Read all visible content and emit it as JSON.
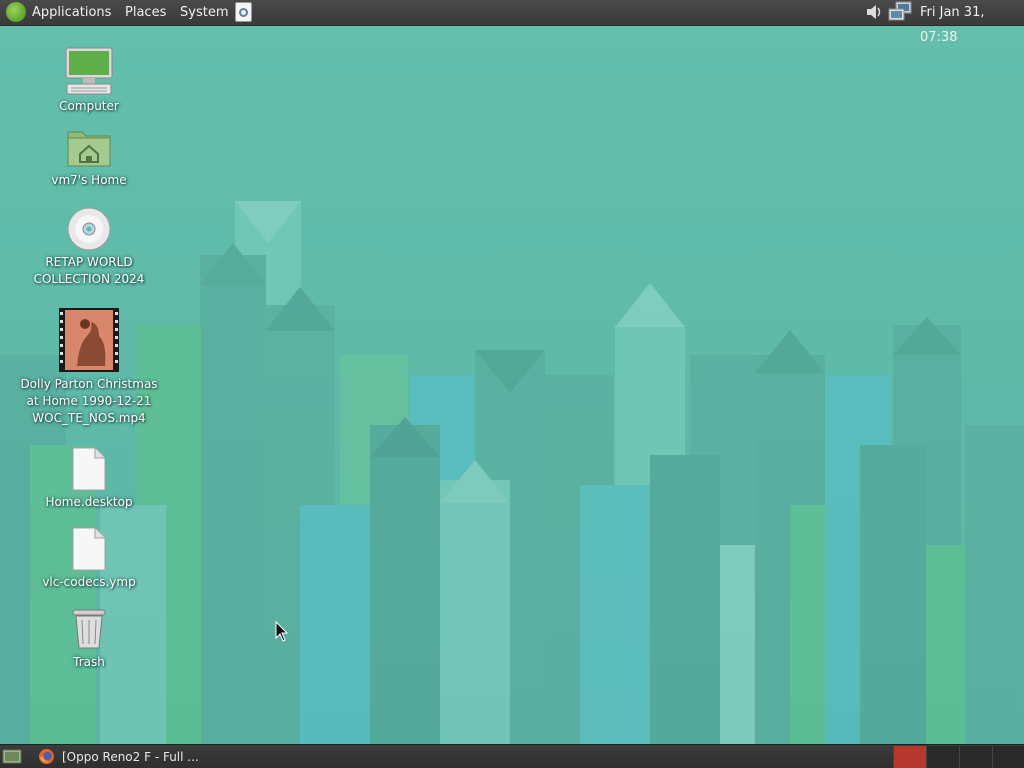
{
  "top_panel": {
    "menus": [
      {
        "label": "Applications",
        "icon": "distro-logo-icon"
      },
      {
        "label": "Places"
      },
      {
        "label": "System"
      }
    ],
    "launcher_icon": "note-launcher-icon",
    "tray_icons": [
      "volume-icon",
      "network-icon"
    ],
    "clock": "Fri Jan 31, 07:38"
  },
  "desktop": {
    "icons": [
      {
        "label": "Computer",
        "icon": "computer-icon"
      },
      {
        "label": "vm7's Home",
        "icon": "home-folder-icon"
      },
      {
        "label": "RETAP WORLD\nCOLLECTION 2024",
        "icon": "optical-disc-icon"
      },
      {
        "label": "Dolly Parton Christmas\nat Home 1990-12-21\nWOC_TE_NOS.mp4",
        "icon": "video-thumbnail-icon"
      },
      {
        "label": "Home.desktop",
        "icon": "document-icon"
      },
      {
        "label": "vlc-codecs.ymp",
        "icon": "document-icon"
      },
      {
        "label": "Trash",
        "icon": "trash-icon"
      }
    ],
    "wallpaper_colors": {
      "base": "#5fbaa8",
      "light": "#7fd0c0",
      "green": "#5ec48a",
      "blue": "#56c0cf"
    }
  },
  "bottom_panel": {
    "task": {
      "label": "[Oppo Reno2 F - Full ...",
      "icon": "firefox-icon"
    },
    "workspaces": [
      {
        "name": "workspace-1",
        "active": true
      },
      {
        "name": "workspace-2",
        "active": false
      },
      {
        "name": "workspace-3",
        "active": false
      },
      {
        "name": "workspace-4",
        "active": false
      }
    ],
    "active_workspace_color": "#b5382e"
  }
}
